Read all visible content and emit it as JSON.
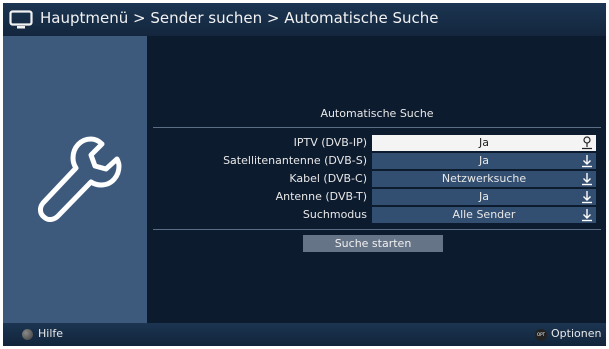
{
  "header": {
    "title": "Hauptmenü > Sender suchen > Automatische Suche",
    "icon": "tv-icon"
  },
  "left_panel": {
    "icon": "wrench-icon"
  },
  "section": {
    "title": "Automatische Suche"
  },
  "settings": [
    {
      "label": "IPTV (DVB-IP)",
      "value": "Ja",
      "active": true,
      "icon": "usb-icon"
    },
    {
      "label": "Satellitenantenne (DVB-S)",
      "value": "Ja",
      "active": false,
      "icon": "arrow-down-icon"
    },
    {
      "label": "Kabel (DVB-C)",
      "value": "Netzwerksuche",
      "active": false,
      "icon": "arrow-down-icon"
    },
    {
      "label": "Antenne (DVB-T)",
      "value": "Ja",
      "active": false,
      "icon": "arrow-down-icon"
    },
    {
      "label": "Suchmodus",
      "value": "Alle Sender",
      "active": false,
      "icon": "arrow-down-icon"
    }
  ],
  "start_button": {
    "label": "Suche starten"
  },
  "footer": {
    "help_label": "Hilfe",
    "options_badge": "OPT",
    "options_label": "Optionen"
  },
  "colors": {
    "background": "#0d1b2e",
    "panel": "#3d5a7d",
    "field": "#324e70",
    "field_active": "#f4f4f4",
    "button": "#667487"
  }
}
